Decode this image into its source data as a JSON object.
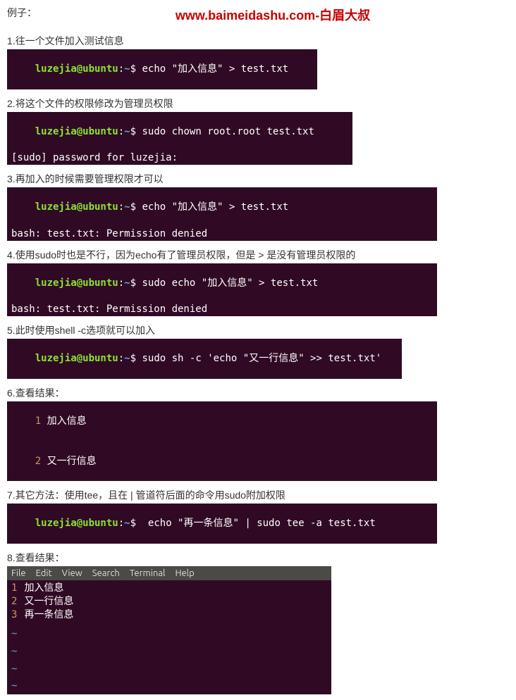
{
  "header": {
    "example_label": "例子：",
    "watermark": "www.baimeidashu.com-白眉大叔"
  },
  "prompt": {
    "user": "luzejia@ubuntu",
    "path": "~",
    "symbol": "$"
  },
  "steps": [
    {
      "n": "1",
      "text": "往一个文件加入测试信息"
    },
    {
      "n": "2",
      "text": "将这个文件的权限修改为管理员权限"
    },
    {
      "n": "3",
      "text": "再加入的时候需要管理权限才可以"
    },
    {
      "n": "4",
      "text": "使用sudo时也是不行，因为echo有了管理员权限，但是 > 是没有管理员权限的"
    },
    {
      "n": "5",
      "text": "此时使用shell -c选项就可以加入"
    },
    {
      "n": "6",
      "text": "查看结果："
    },
    {
      "n": "7",
      "text": "其它方法：使用tee，且在 | 管道符后面的命令用sudo附加权限"
    },
    {
      "n": "8",
      "text": "查看结果："
    }
  ],
  "blocks": {
    "b1": {
      "cmd": "echo \"加入信息\" > test.txt"
    },
    "b2": {
      "cmd": "sudo chown root.root test.txt",
      "out": "[sudo] password for luzejia:"
    },
    "b3": {
      "cmd": "echo \"加入信息\" > test.txt",
      "out": "bash: test.txt: Permission denied"
    },
    "b4": {
      "cmd": "sudo echo \"加入信息\" > test.txt",
      "out": "bash: test.txt: Permission denied"
    },
    "b5": {
      "cmd": "sudo sh -c 'echo \"又一行信息\" >> test.txt'"
    },
    "b6": {
      "lines": [
        {
          "num": "1",
          "text": "加入信息"
        },
        {
          "num": "2",
          "text": "又一行信息"
        }
      ]
    },
    "b7": {
      "cmd": " echo \"再一条信息\" | sudo tee -a test.txt"
    },
    "b8": {
      "menu": [
        "File",
        "Edit",
        "View",
        "Search",
        "Terminal",
        "Help"
      ],
      "lines": [
        {
          "num": "1",
          "text": "加入信息"
        },
        {
          "num": "2",
          "text": "又一行信息"
        },
        {
          "num": "3",
          "text": "再一条信息"
        }
      ],
      "tildes": [
        "~",
        "~",
        "~",
        "~"
      ]
    }
  }
}
